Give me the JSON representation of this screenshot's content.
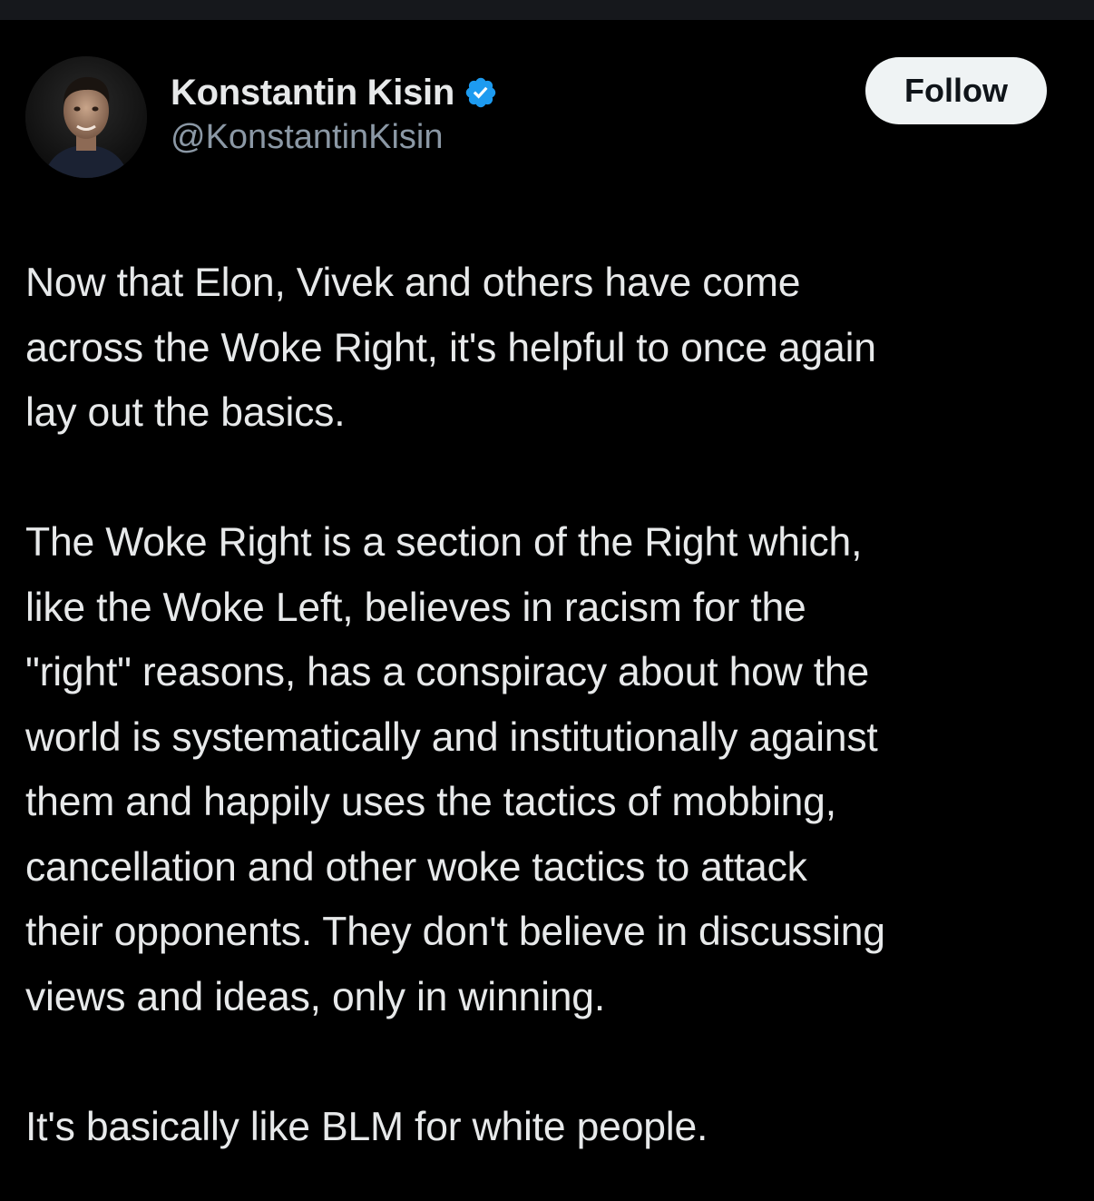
{
  "author": {
    "display_name": "Konstantin Kisin",
    "handle": "@KonstantinKisin",
    "verified_icon": "verified-badge-icon",
    "verified_color": "#1d9bf0"
  },
  "follow_button": {
    "label": "Follow"
  },
  "tweet": {
    "paragraphs": [
      "Now that Elon, Vivek and others have come\nacross the Woke Right, it's helpful to once again\nlay out the basics.",
      "The Woke Right is a section of the Right which,\nlike the Woke Left, believes in racism for the\n\"right\" reasons, has a conspiracy about how the\nworld is systematically and institutionally against\nthem and happily uses the tactics of mobbing,\ncancellation and other woke tactics to attack\ntheir opponents. They don't believe in discussing\nviews and ideas, only in winning.",
      "It's basically like BLM for white people."
    ]
  },
  "colors": {
    "background": "#000000",
    "text_primary": "#e7e9ea",
    "text_secondary": "#8b98a5",
    "button_bg": "#eff3f4"
  }
}
